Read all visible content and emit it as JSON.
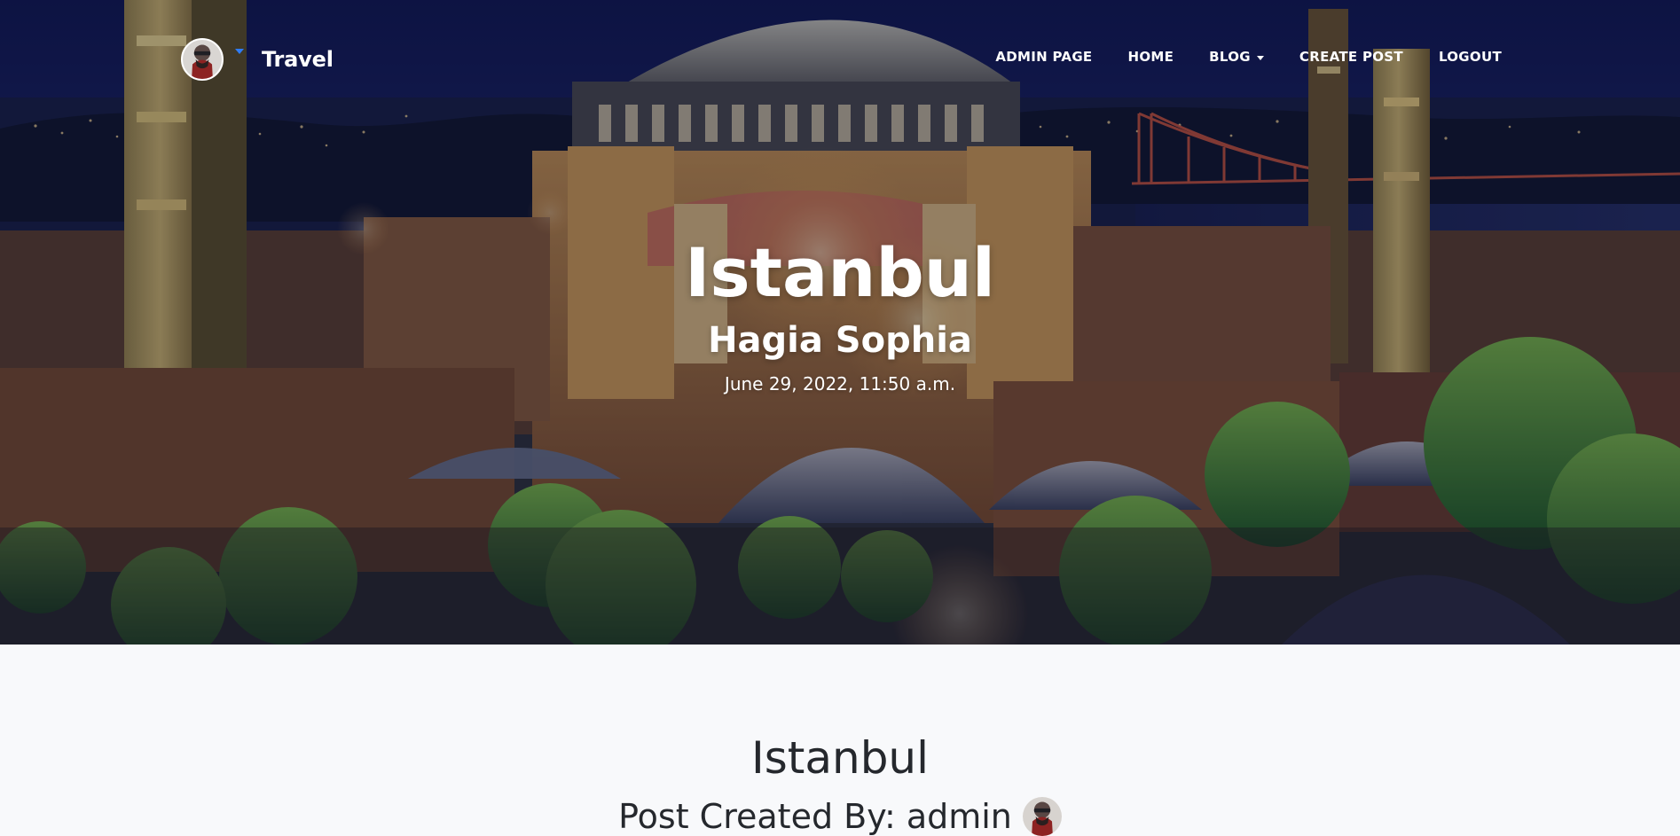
{
  "header": {
    "brand": {
      "title": "Travel",
      "avatar_icon": "profile-photo-icon",
      "caret_icon": "chevron-down-icon",
      "caret_color": "#2f7df6"
    },
    "nav": [
      {
        "label": "ADMIN PAGE"
      },
      {
        "label": "HOME"
      },
      {
        "label": "BLOG",
        "dropdown_icon": "chevron-down-icon"
      },
      {
        "label": "CREATE POST"
      },
      {
        "label": "LOGOUT"
      }
    ]
  },
  "hero": {
    "title": "Istanbul",
    "subtitle": "Hagia Sophia",
    "date": "June 29, 2022, 11:50 a.m.",
    "overlay_color": "#080a18"
  },
  "post": {
    "title": "Istanbul",
    "author_prefix": "Post Created By: ",
    "author_name": "admin",
    "author_avatar_icon": "profile-photo-icon"
  },
  "colors": {
    "page_background": "#f8f9fb",
    "text_dark": "#25282d",
    "night_sky": "#1b2257",
    "sea": "#1a235c"
  }
}
